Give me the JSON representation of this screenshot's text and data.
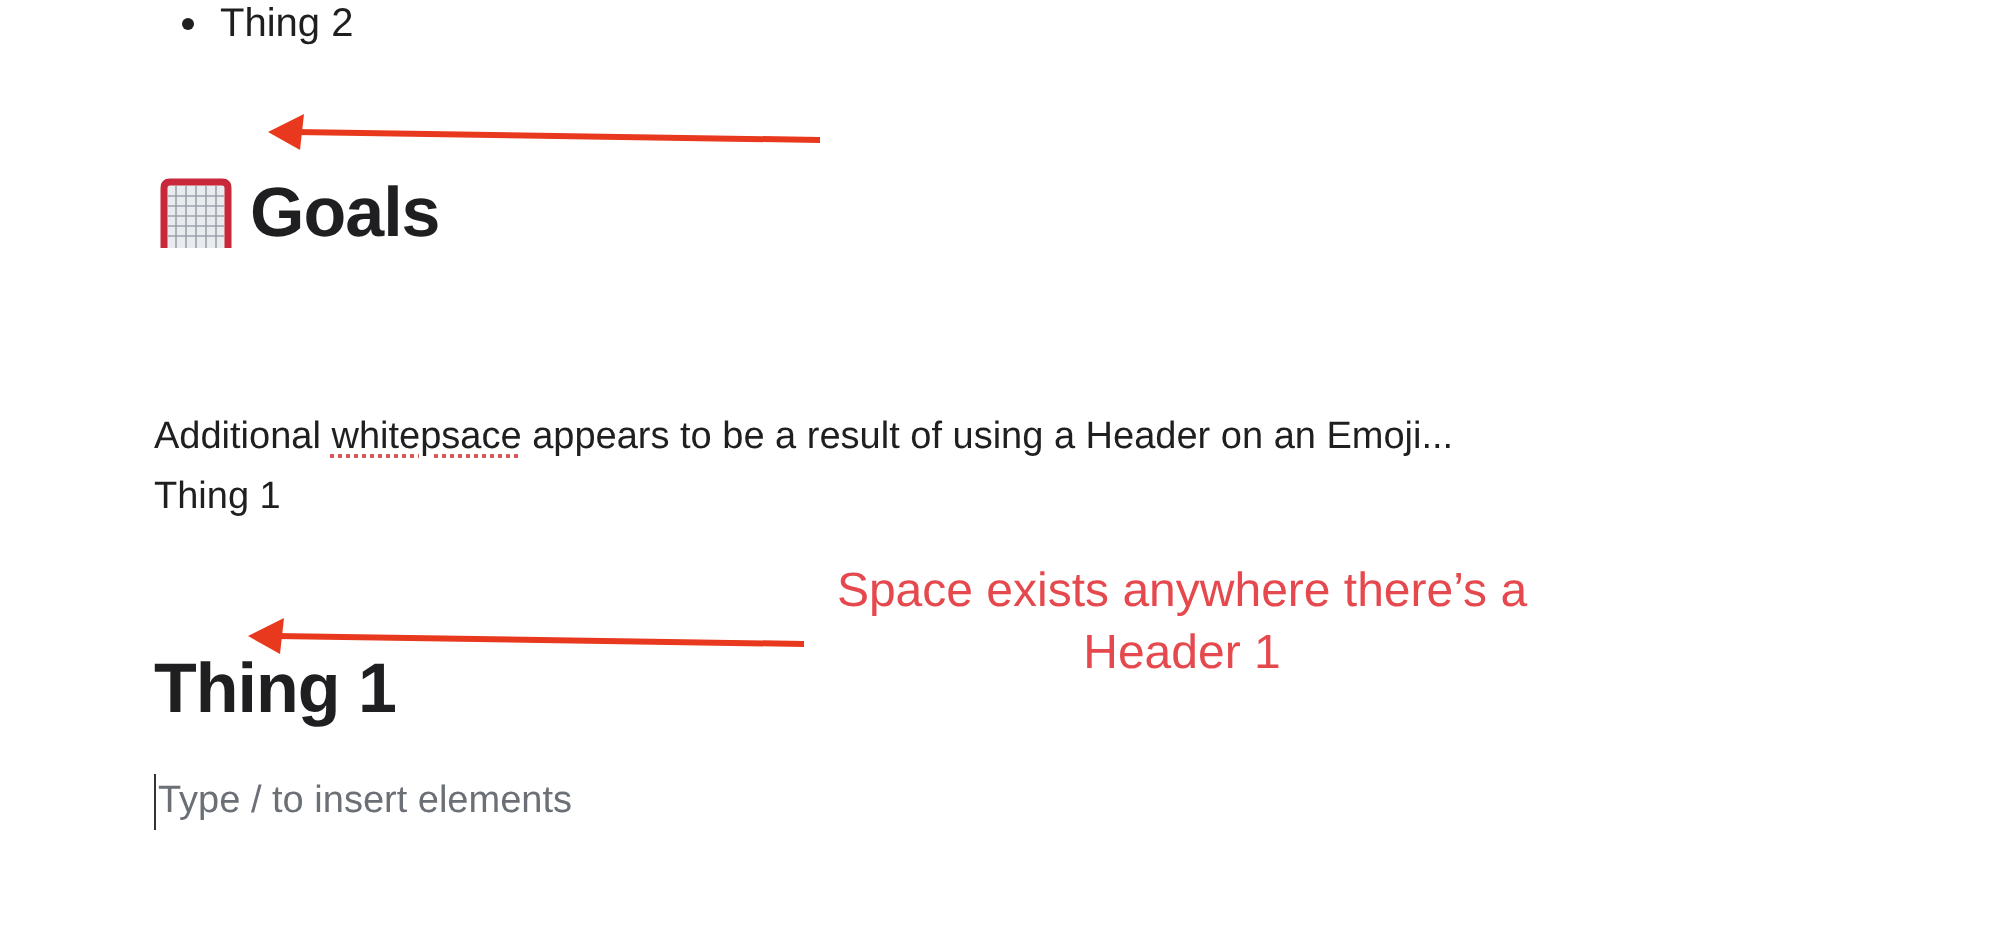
{
  "editor": {
    "blocks": [
      {
        "kind": "bullet",
        "text": "Thing 2"
      },
      {
        "kind": "heading",
        "has_icon": true,
        "text": "Goals"
      },
      {
        "kind": "paragraph",
        "segments": [
          {
            "text": "Additional ",
            "misspelled": false
          },
          {
            "text": "whitepsace",
            "misspelled": true
          },
          {
            "text": " appears to be a result of using a Header on an Emoji...",
            "misspelled": false
          }
        ]
      },
      {
        "kind": "paragraph",
        "segments": [
          {
            "text": "Thing 1",
            "misspelled": false
          }
        ]
      },
      {
        "kind": "heading",
        "has_icon": false,
        "text": "Thing 1"
      },
      {
        "kind": "input",
        "placeholder": "Type / to insert elements"
      }
    ]
  },
  "annotations": {
    "note": "Space exists anywhere there’s a Header 1"
  }
}
